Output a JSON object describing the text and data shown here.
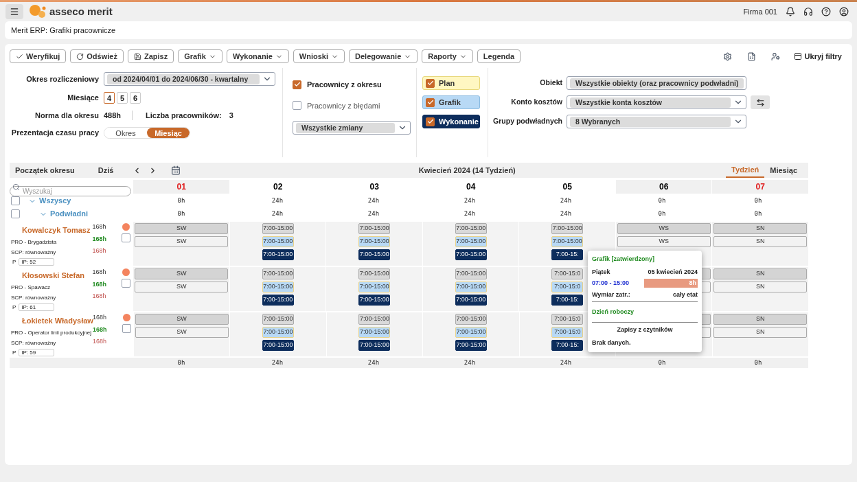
{
  "app": {
    "brand": "asseco merit",
    "company": "Firma 001"
  },
  "breadcrumb": "Merit ERP: Grafiki pracownicze",
  "toolbar": [
    {
      "label": "Weryfikuj",
      "kind": "verify"
    },
    {
      "label": "Odśwież",
      "kind": "refresh"
    },
    {
      "label": "Zapisz",
      "kind": "save"
    },
    {
      "label": "Grafik",
      "kind": "menu"
    },
    {
      "label": "Wykonanie",
      "kind": "menu"
    },
    {
      "label": "Wnioski",
      "kind": "menu"
    },
    {
      "label": "Delegowanie",
      "kind": "menu"
    },
    {
      "label": "Raporty",
      "kind": "menu"
    },
    {
      "label": "Legenda",
      "kind": "plain"
    }
  ],
  "hide_filters": "Ukryj filtry",
  "filters": {
    "period": {
      "label": "Okres rozliczeniowy",
      "value": "od 2024/04/01 do 2024/06/30 - kwartalny"
    },
    "months": {
      "label": "Miesiące",
      "items": [
        {
          "label": "4",
          "selected": true
        },
        {
          "label": "5",
          "selected": false
        },
        {
          "label": "6",
          "selected": false
        }
      ]
    },
    "norm": {
      "label": "Norma dla okresu",
      "value": "488h"
    },
    "employees_count": {
      "label": "Liczba pracowników:",
      "value": "3"
    },
    "presentation": {
      "label": "Prezentacja czasu pracy",
      "options": [
        {
          "label": "Okres",
          "selected": false
        },
        {
          "label": "Miesiąc",
          "selected": true
        }
      ]
    },
    "checks": [
      {
        "label": "Pracownicy z okresu",
        "checked": true
      },
      {
        "label": "Pracownicy z błędami",
        "checked": false
      }
    ],
    "shifts_select": "Wszystkie zmiany",
    "layers": [
      {
        "label": "Plan",
        "checked": true,
        "kind": "plan"
      },
      {
        "label": "Grafik",
        "checked": true,
        "kind": "grafik"
      },
      {
        "label": "Wykonanie",
        "checked": true,
        "kind": "wykonanie"
      }
    ],
    "selects": [
      {
        "label": "Obiekt",
        "value": "Wszystkie obiekty (oraz pracownicy podwładni)",
        "swap": false
      },
      {
        "label": "Konto kosztów",
        "value": "Wszystkie konta kosztów",
        "swap": true
      },
      {
        "label": "Grupy podwładnych",
        "value": "8 Wybranych",
        "swap": false
      }
    ]
  },
  "calendar": {
    "start": "Początek okresu",
    "today": "Dziś",
    "title": "Kwiecień 2024 (14 Tydzień)",
    "views": [
      {
        "label": "Tydzień",
        "selected": true
      },
      {
        "label": "Miesiąc",
        "selected": false
      }
    ],
    "search_placeholder": "Wyszukaj",
    "days": [
      {
        "label": "01",
        "kind": "free",
        "holiday": true
      },
      {
        "label": "02",
        "kind": "workday",
        "holiday": false
      },
      {
        "label": "03",
        "kind": "workday",
        "holiday": false
      },
      {
        "label": "04",
        "kind": "workday",
        "holiday": false
      },
      {
        "label": "05",
        "kind": "workday",
        "holiday": false
      },
      {
        "label": "06",
        "kind": "free",
        "holiday": false
      },
      {
        "label": "07",
        "kind": "free",
        "holiday": true
      }
    ],
    "groups": [
      {
        "label": "Wszyscy",
        "expanded": true,
        "checked": false,
        "hours": [
          "0h",
          "24h",
          "24h",
          "24h",
          "24h",
          "0h",
          "0h"
        ],
        "children": [
          {
            "label": "Podwładni",
            "expanded": true,
            "checked": false,
            "hours": [
              "0h",
              "24h",
              "24h",
              "24h",
              "24h",
              "0h",
              "0h"
            ]
          }
        ]
      }
    ],
    "employees": [
      {
        "name": "Kowalczyk Tomasz",
        "role": "PRO - Brygadzista",
        "scp": "SCP: równoważny",
        "p": "P",
        "ip": "IP: 52",
        "hours": [
          "168h",
          "168h",
          "168h"
        ],
        "color": "#f4845f",
        "checked": false,
        "cells": [
          [
            {
              "kind": "plan",
              "label": "SW"
            },
            {
              "kind": "grafik",
              "label": "SW"
            }
          ],
          [
            {
              "kind": "plan",
              "label": "7:00-15:00"
            },
            {
              "kind": "grafik",
              "label": "7:00-15:00"
            },
            {
              "kind": "wykonanie",
              "label": "7:00-15:00"
            }
          ],
          [
            {
              "kind": "plan",
              "label": "7:00-15:00"
            },
            {
              "kind": "grafik",
              "label": "7:00-15:00"
            },
            {
              "kind": "wykonanie",
              "label": "7:00-15:00"
            }
          ],
          [
            {
              "kind": "plan",
              "label": "7:00-15:00"
            },
            {
              "kind": "grafik",
              "label": "7:00-15:00"
            },
            {
              "kind": "wykonanie",
              "label": "7:00-15:00"
            }
          ],
          [
            {
              "kind": "plan",
              "label": "7:00-15:00"
            },
            {
              "kind": "grafik",
              "label": "7:00-15:00"
            },
            {
              "kind": "wykonanie",
              "label": "7:00-15:"
            }
          ],
          [
            {
              "kind": "plan",
              "label": "WS"
            },
            {
              "kind": "grafik",
              "label": "WS"
            }
          ],
          [
            {
              "kind": "plan",
              "label": "SN"
            },
            {
              "kind": "grafik",
              "label": "SN"
            }
          ]
        ]
      },
      {
        "name": "Kłosowski Stefan",
        "role": "PRO - Spawacz",
        "scp": "SCP: równoważny",
        "p": "P",
        "ip": "IP: 61",
        "hours": [
          "168h",
          "168h",
          "168h"
        ],
        "color": "#f4845f",
        "checked": false,
        "cells": [
          [
            {
              "kind": "plan",
              "label": "SW"
            },
            {
              "kind": "grafik",
              "label": "SW"
            }
          ],
          [
            {
              "kind": "plan",
              "label": "7:00-15:00"
            },
            {
              "kind": "grafik",
              "label": "7:00-15:00"
            },
            {
              "kind": "wykonanie",
              "label": "7:00-15:00"
            }
          ],
          [
            {
              "kind": "plan",
              "label": "7:00-15:00"
            },
            {
              "kind": "grafik",
              "label": "7:00-15:00"
            },
            {
              "kind": "wykonanie",
              "label": "7:00-15:00"
            }
          ],
          [
            {
              "kind": "plan",
              "label": "7:00-15:00"
            },
            {
              "kind": "grafik",
              "label": "7:00-15:00"
            },
            {
              "kind": "wykonanie",
              "label": "7:00-15:00"
            }
          ],
          [
            {
              "kind": "plan",
              "label": "7:00-15:0"
            },
            {
              "kind": "grafik",
              "label": "7:00-15:0"
            },
            {
              "kind": "wykonanie",
              "label": "7:00-15:"
            }
          ],
          [
            {
              "kind": "plan"
            },
            {
              "kind": "grafik"
            }
          ],
          [
            {
              "kind": "plan",
              "label": "SN"
            },
            {
              "kind": "grafik",
              "label": "SN"
            }
          ]
        ]
      },
      {
        "name": "Łokietek Władysław",
        "role": "PRO - Operator linii produkcyjnej",
        "scp": "SCP: równoważny",
        "p": "P",
        "ip": "IP: 59",
        "hours": [
          "168h",
          "168h",
          "168h"
        ],
        "color": "#f4845f",
        "checked": false,
        "cells": [
          [
            {
              "kind": "plan",
              "label": "SW"
            },
            {
              "kind": "grafik",
              "label": "SW"
            }
          ],
          [
            {
              "kind": "plan",
              "label": "7:00-15:00"
            },
            {
              "kind": "grafik",
              "label": "7:00-15:00"
            },
            {
              "kind": "wykonanie",
              "label": "7:00-15:00"
            }
          ],
          [
            {
              "kind": "plan",
              "label": "7:00-15:00"
            },
            {
              "kind": "grafik",
              "label": "7:00-15:00"
            },
            {
              "kind": "wykonanie",
              "label": "7:00-15:00"
            }
          ],
          [
            {
              "kind": "plan",
              "label": "7:00-15:00"
            },
            {
              "kind": "grafik",
              "label": "7:00-15:00"
            },
            {
              "kind": "wykonanie",
              "label": "7:00-15:00"
            }
          ],
          [
            {
              "kind": "plan",
              "label": "7:00-15:0"
            },
            {
              "kind": "grafik",
              "label": "7:00-15:0"
            },
            {
              "kind": "wykonanie",
              "label": "7:00-15:"
            }
          ],
          [
            {
              "kind": "plan"
            },
            {
              "kind": "grafik"
            }
          ],
          [
            {
              "kind": "plan",
              "label": "SN"
            },
            {
              "kind": "grafik",
              "label": "SN"
            }
          ]
        ]
      }
    ],
    "totals": [
      "0h",
      "24h",
      "24h",
      "24h",
      "24h",
      "0h",
      "0h"
    ],
    "tooltip": {
      "title": "Grafik [zatwierdzony]",
      "day": "Piątek",
      "date": "05 kwiecień 2024",
      "time": "07:00 - 15:00",
      "hours": "8h",
      "level": 1,
      "employment_label": "Wymiar zatr.:",
      "employment_value": "cały etat",
      "day_type": "Dzień roboczy",
      "readers_title": "Zapisy z czytników",
      "readers_value": "Brak danych."
    }
  }
}
